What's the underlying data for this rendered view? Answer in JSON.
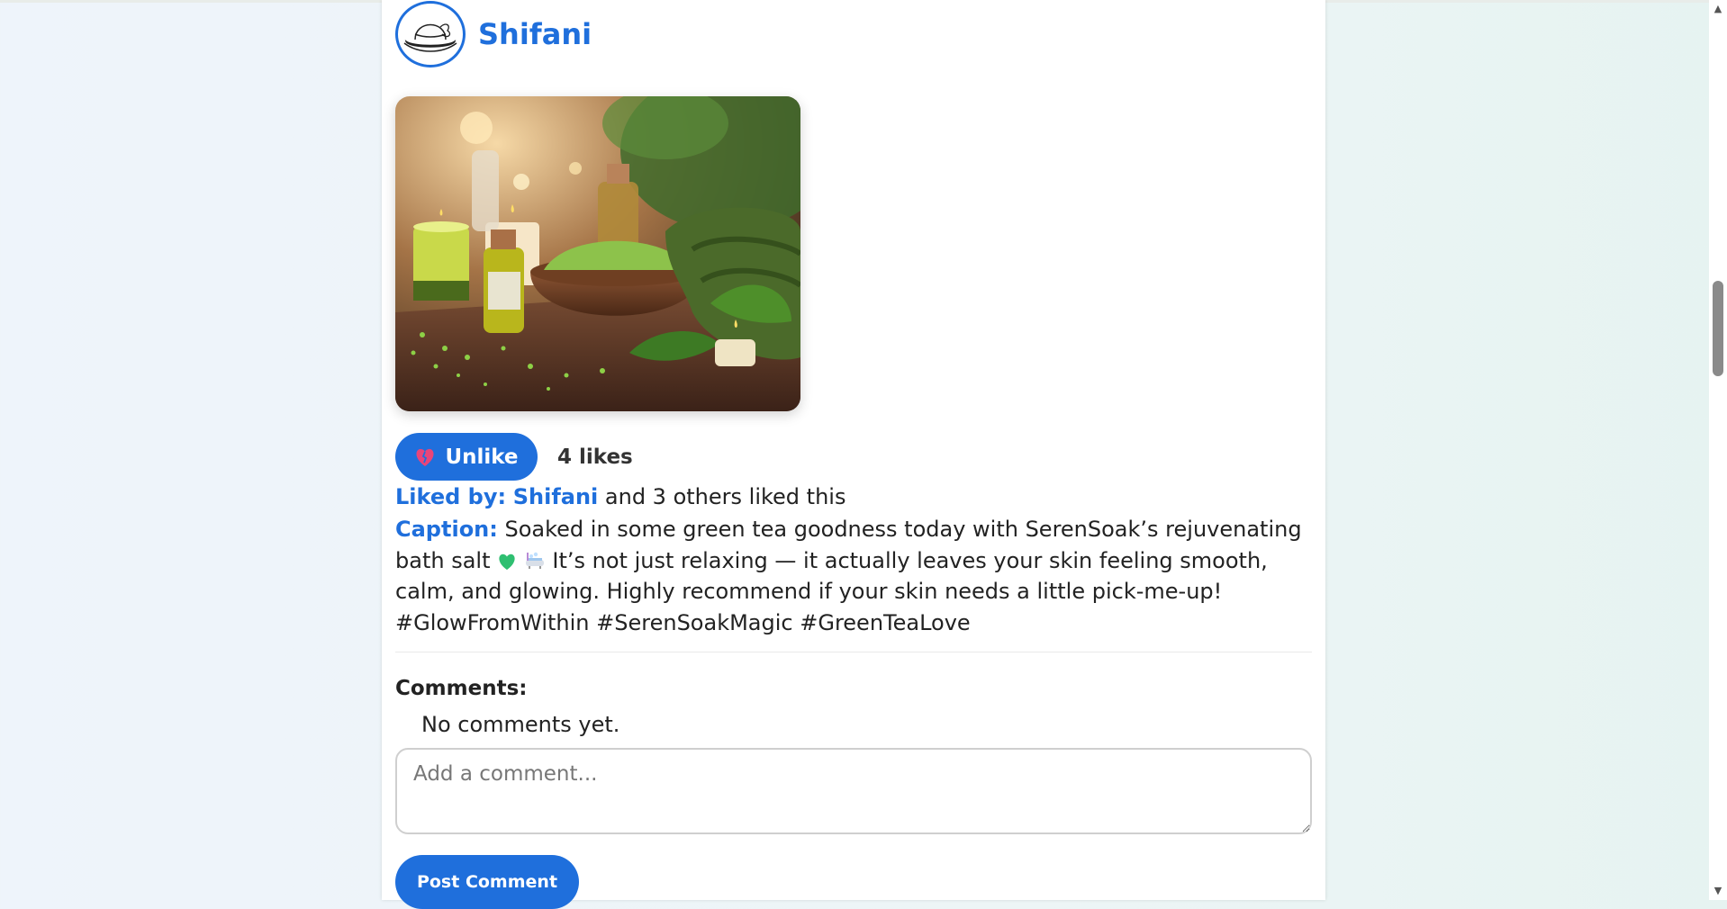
{
  "post": {
    "username": "Shifani",
    "image_alt": "Green tea bath salt in a wooden bowl with candles and oil bottles",
    "unlike_label": "Unlike",
    "unlike_icon": "broken-heart-icon",
    "likes_count": "4 likes",
    "liked_by_label": "Liked by:",
    "liked_by_name": "Shifani",
    "liked_by_suffix": " and 3 others liked this",
    "caption_label": "Caption:",
    "caption_text_1": " Soaked in some green tea goodness today with SerenSoak’s rejuvenating bath salt ",
    "caption_emoji_1": "green-heart-icon",
    "caption_emoji_2": "bathtub-icon",
    "caption_text_2": " It’s not just relaxing — it actually leaves your skin feeling smooth, calm, and glowing. Highly recommend if your skin needs a little pick-me-up! #GlowFromWithin #SerenSoakMagic #GreenTeaLove"
  },
  "comments": {
    "title": "Comments:",
    "empty_text": "No comments yet.",
    "input_placeholder": "Add a comment...",
    "post_button_label": "Post Comment"
  },
  "colors": {
    "accent": "#1f6fdc",
    "card_bg": "#ffffff",
    "page_bg": "#eef4fb"
  }
}
